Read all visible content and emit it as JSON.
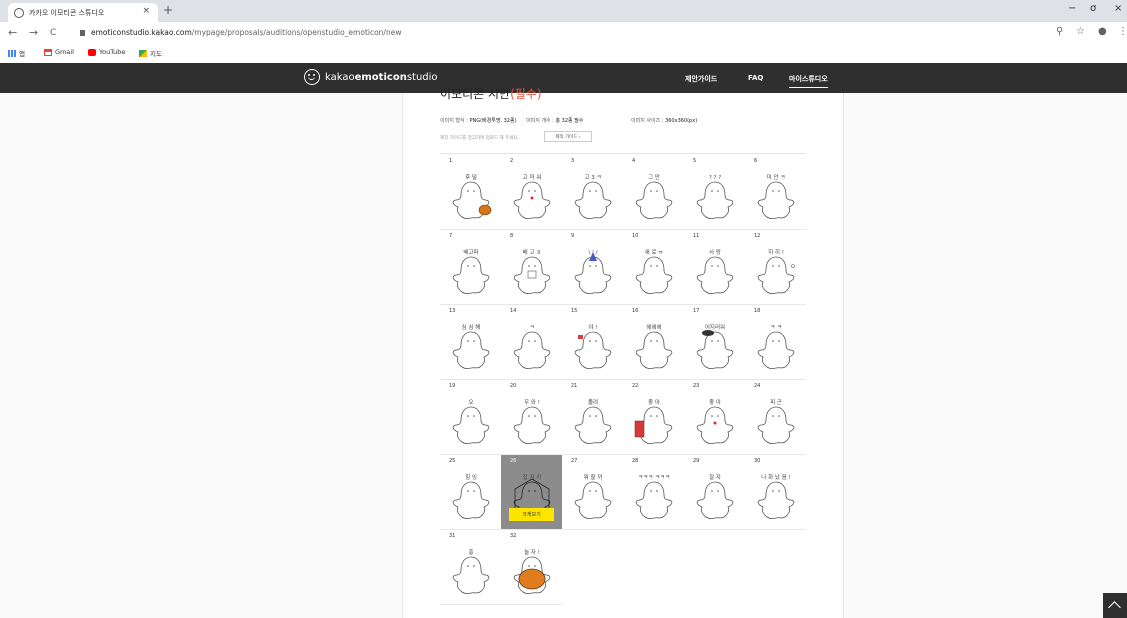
{
  "browser": {
    "tab_title": "카카오 이모티콘 스튜디오",
    "tab_close": "×",
    "new_tab": "+",
    "url_host": "emoticonstudio.kakao.com",
    "url_path": "/mypage/proposals/auditions/openstudio_emoticon/new",
    "nav": {
      "back": "←",
      "forward": "→",
      "reload": "C"
    },
    "window": {
      "minimize": "−",
      "maximize": "σ",
      "close": "×"
    },
    "addr_icons": {
      "zoom": "⚲",
      "star": "☆",
      "profile": "●",
      "menu": "⋮"
    },
    "bookmarks": [
      {
        "label": "앱",
        "color": "#4285f4"
      },
      {
        "label": "Gmail",
        "color": "#ea4335"
      },
      {
        "label": "YouTube",
        "color": "#ff0000"
      },
      {
        "label": "지도",
        "color": "#34a853"
      }
    ]
  },
  "header": {
    "logo_plain": "kakao",
    "logo_bold": "emoticon",
    "logo_suffix": " studio",
    "nav": [
      {
        "label": "제안가이드",
        "active": false
      },
      {
        "label": "FAQ",
        "active": false
      },
      {
        "label": "마이스튜디오",
        "active": true
      }
    ]
  },
  "content": {
    "section_title": "이모티콘 시안",
    "section_required": "(필수)",
    "spec_format_label": "이미지 형식 : ",
    "spec_format_value": "PNG(배경투명, 32종)",
    "spec_count_label": "이미지 개수 : ",
    "spec_count_value": "총 32종 필수",
    "spec_size_label": "이미지 사이즈 : ",
    "spec_size_value": "360x360(px)",
    "guide_note": "제작 가이드를 참고하여 업로드 해 주세요.",
    "guide_button": "제작 가이드 ›",
    "hover_button": "크게보기",
    "selected_index": 26,
    "items": [
      {
        "n": "1",
        "cap": "후 덜",
        "extra": "pumpkin"
      },
      {
        "n": "2",
        "cap": "고 마 워",
        "extra": "heart"
      },
      {
        "n": "3",
        "cap": "고 3 ㅋ",
        "extra": ""
      },
      {
        "n": "4",
        "cap": "그 만",
        "extra": ""
      },
      {
        "n": "5",
        "cap": "? ? ?",
        "extra": ""
      },
      {
        "n": "6",
        "cap": "미 안 ㅋ",
        "extra": ""
      },
      {
        "n": "7",
        "cap": "배고파",
        "extra": ""
      },
      {
        "n": "8",
        "cap": "배 고 ㅍ",
        "extra": "box"
      },
      {
        "n": "9",
        "cap": "\\ | /",
        "extra": "hat"
      },
      {
        "n": "10",
        "cap": "새 로 ㅠ",
        "extra": ""
      },
      {
        "n": "11",
        "cap": "사 랑",
        "extra": ""
      },
      {
        "n": "12",
        "cap": "히 히 !",
        "extra": "stars"
      },
      {
        "n": "13",
        "cap": "심 심 해",
        "extra": ""
      },
      {
        "n": "14",
        "cap": "ㅋ",
        "extra": ""
      },
      {
        "n": "15",
        "cap": "야 !",
        "extra": "flag"
      },
      {
        "n": "16",
        "cap": "헤헤헤",
        "extra": ""
      },
      {
        "n": "17",
        "cap": "어지러워",
        "extra": "scribble"
      },
      {
        "n": "18",
        "cap": "ㅋ ㅋ",
        "extra": ""
      },
      {
        "n": "19",
        "cap": "오",
        "extra": ""
      },
      {
        "n": "20",
        "cap": "우 와 !",
        "extra": ""
      },
      {
        "n": "21",
        "cap": "졸려",
        "extra": ""
      },
      {
        "n": "22",
        "cap": "좋 아",
        "extra": "gift"
      },
      {
        "n": "23",
        "cap": "좋 아",
        "extra": "heart"
      },
      {
        "n": "24",
        "cap": "피 곤",
        "extra": "zzz"
      },
      {
        "n": "25",
        "cap": "힝 잉",
        "extra": ""
      },
      {
        "n": "26",
        "cap": "집 지 키",
        "extra": "house"
      },
      {
        "n": "27",
        "cap": "뭐 할 까",
        "extra": ""
      },
      {
        "n": "28",
        "cap": "ㅋㅋㅋ ㅋㅋㅋ",
        "extra": ""
      },
      {
        "n": "29",
        "cap": "잘 자 ",
        "extra": ""
      },
      {
        "n": "30",
        "cap": "나 화 났 음 !",
        "extra": ""
      },
      {
        "n": "31",
        "cap": "흥",
        "extra": ""
      },
      {
        "n": "32",
        "cap": "놀 자 !",
        "extra": "pumpkin-big"
      }
    ]
  }
}
